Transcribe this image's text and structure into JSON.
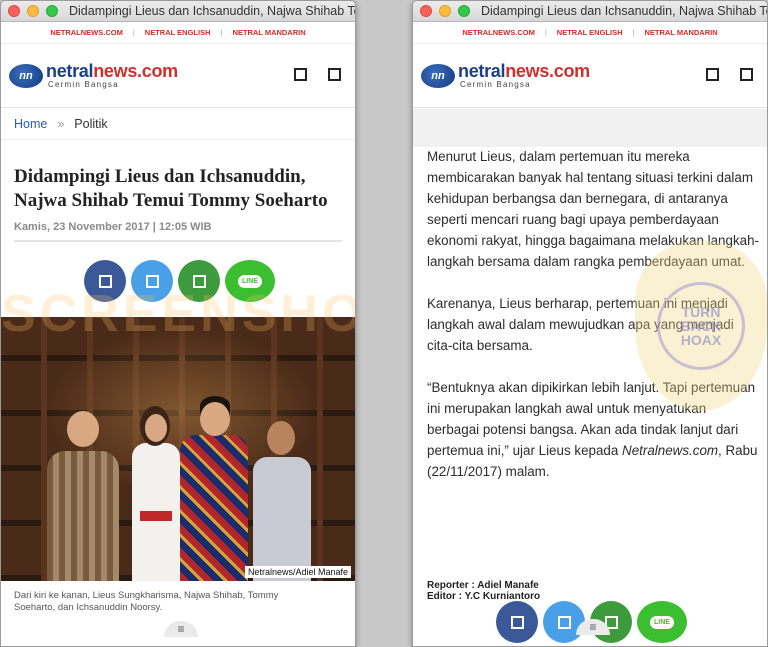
{
  "window_title": "Didampingi Lieus dan Ichsanuddin, Najwa Shihab Temui Tommy Soeharto",
  "topnav": [
    "NETRALNEWS.COM",
    "NETRAL ENGLISH",
    "NETRAL MANDARIN"
  ],
  "logo": {
    "part1": "netral",
    "part2": "news.com",
    "tagline": "Cermin Bangsa"
  },
  "breadcrumb": {
    "home": "Home",
    "separator": "»",
    "category": "Politik"
  },
  "article": {
    "title": "Didampingi Lieus dan Ichsanuddin, Najwa Shihab Temui Tommy Soeharto",
    "meta": "Kamis, 23 November 2017 | 12:05 WIB",
    "photo_credit": "Netralnews/Adiel Manafe",
    "caption": "Dari kiri ke kanan, Lieus Sungkharisma, Najwa Shihab, Tommy Soeharto, dan Ichsanuddin Noorsy.",
    "paragraphs": [
      "Menurut Lieus, dalam pertemuan itu mereka membicarakan banyak hal tentang situasi terkini dalam kehidupan berbangsa dan bernegara, di antaranya seperti mencari ruang bagi upaya pemberdayaan ekonomi rakyat, hingga bagaimana melakukan langkah-langkah bersama dalam rangka pemberdayaan umat.",
      "Karenanya, Lieus berharap, pertemuan ini menjadi langkah awal dalam mewujudkan apa yang menjadi cita-cita bersama.",
      "“Bentuknya akan dipikirkan lebih lanjut. Tapi pertemuan ini merupakan langkah awal untuk menyatukan berbagai potensi bangsa. Akan ada tindak lanjut dari pertemua ini,” ujar Lieus kepada"
    ],
    "last_italic": "Netralnews.com",
    "last_tail": ", Rabu (22/11/2017) malam.",
    "reporter": "Reporter : Adiel Manafe",
    "editor": "Editor : Y.C Kurniantoro"
  },
  "share": {
    "line_label": "LINE"
  },
  "menu_icon": "≡",
  "watermark": "SCREENSHOT BY",
  "seal": {
    "line1": "TURN",
    "line2": "BACK",
    "line3": "HOAX"
  },
  "colors": {
    "accent_red": "#d32a2a",
    "brand_blue": "#1d3e8a",
    "link_blue": "#2a5bb8"
  }
}
